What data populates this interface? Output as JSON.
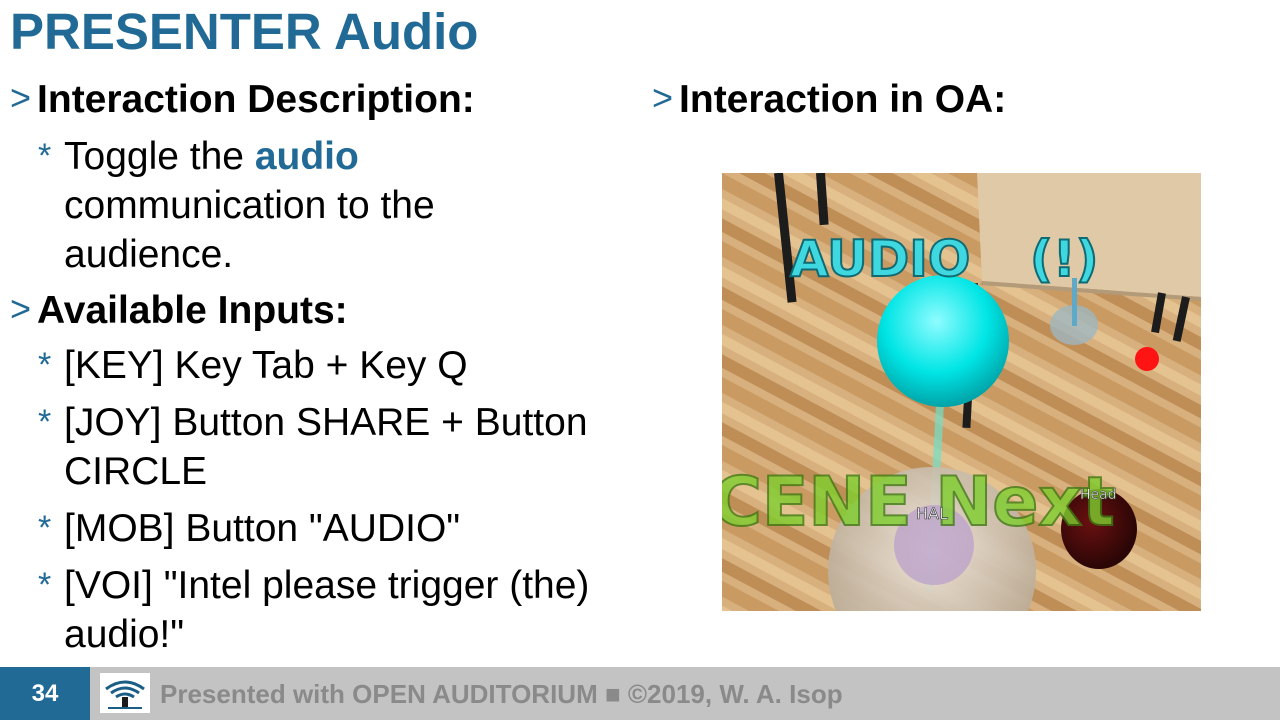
{
  "title": "PRESENTER Audio",
  "left": {
    "heading1": "Interaction Description:",
    "desc_pre": "Toggle the ",
    "desc_hl": "audio",
    "desc_line2": "communication to the",
    "desc_line3": "audience.",
    "heading2": "Available Inputs:",
    "inputs": [
      {
        "line1": "[KEY] Key Tab + Key Q",
        "line2": ""
      },
      {
        "line1": "[JOY] Button SHARE + Button",
        "line2": "CIRCLE"
      },
      {
        "line1": "[MOB] Button \"AUDIO\"",
        "line2": ""
      },
      {
        "line1": "[VOI] \"Intel please trigger (the)",
        "line2": "audio!\""
      }
    ]
  },
  "right": {
    "heading": "Interaction in OA:",
    "scene_label_audio": "AUDIO",
    "scene_label_excl": "(!)",
    "scene_label_next": "CENE Next",
    "scene_label_hal": "HAL",
    "scene_label_head": "Head"
  },
  "footer": {
    "page_number": "34",
    "text": "Presented with OPEN AUDITORIUM ■ ©2019, W. A. Isop"
  },
  "colors": {
    "accent": "#216a95",
    "footer_bg": "#c3c3c3"
  }
}
